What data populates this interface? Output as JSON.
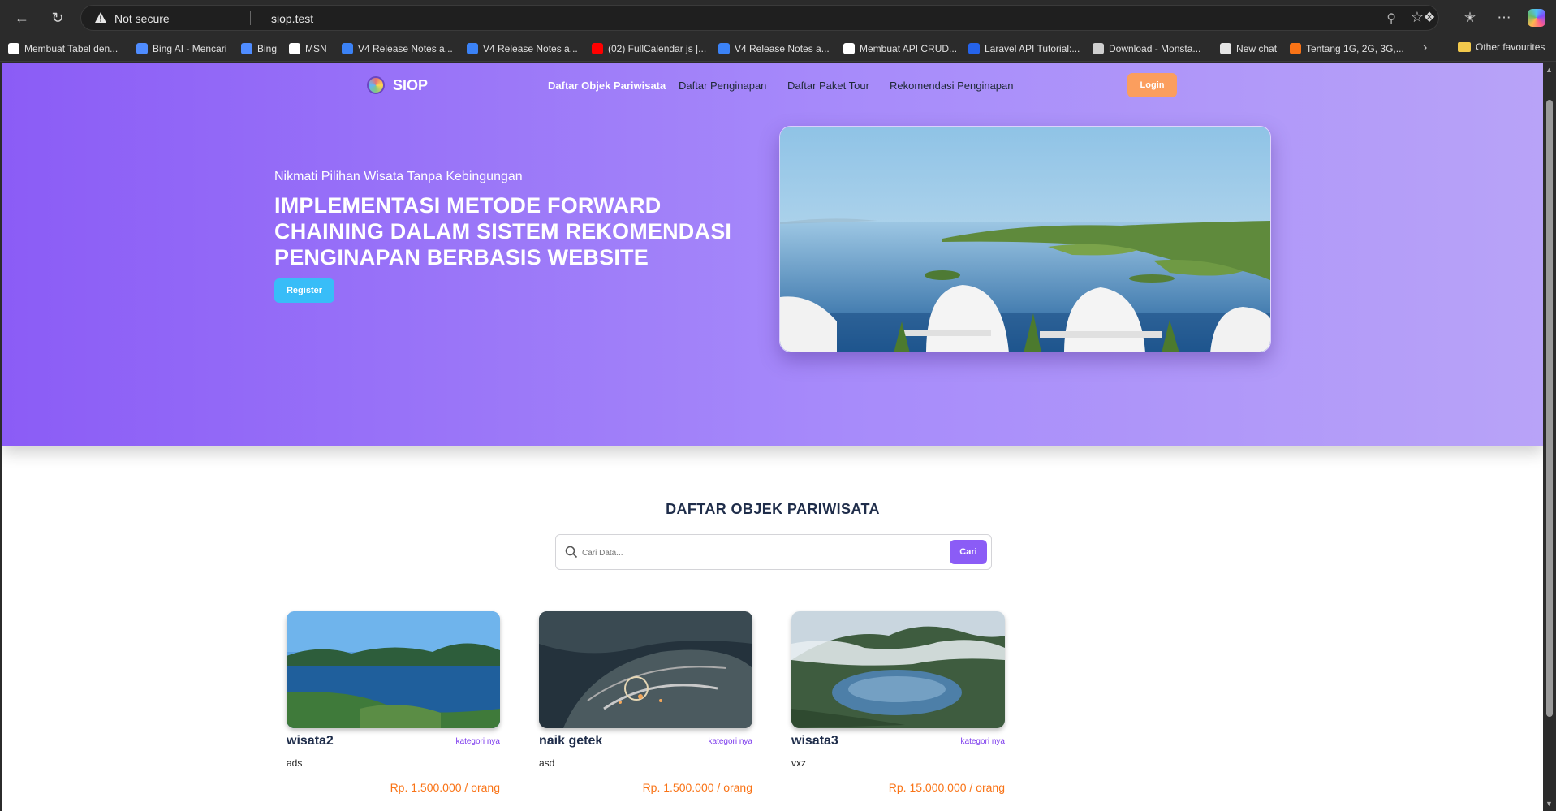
{
  "browser": {
    "security_label": "Not secure",
    "url": "siop.test",
    "bookmarks": [
      {
        "label": "Membuat Tabel den...",
        "icon": "medium-icon",
        "color": "#ffffff"
      },
      {
        "label": "Bing AI - Mencari",
        "icon": "bing-search-icon",
        "color": "#4f8cff"
      },
      {
        "label": "Bing",
        "icon": "bing-search-icon",
        "color": "#4f8cff"
      },
      {
        "label": "MSN",
        "icon": "msn-icon",
        "color": "#ffffff"
      },
      {
        "label": "V4 Release Notes a...",
        "icon": "page-icon",
        "color": "#3b82f6"
      },
      {
        "label": "V4 Release Notes a...",
        "icon": "page-icon",
        "color": "#3b82f6"
      },
      {
        "label": "(02) FullCalendar js |...",
        "icon": "youtube-icon",
        "color": "#ff0000"
      },
      {
        "label": "V4 Release Notes a...",
        "icon": "page-icon",
        "color": "#3b82f6"
      },
      {
        "label": "Membuat API CRUD...",
        "icon": "medium-icon",
        "color": "#ffffff"
      },
      {
        "label": "Laravel API Tutorial:...",
        "icon": "laravel-icon",
        "color": "#2563eb"
      },
      {
        "label": "Download - Monsta...",
        "icon": "document-icon",
        "color": "#cfcfcf"
      },
      {
        "label": "New chat",
        "icon": "openai-icon",
        "color": "#e5e5e5"
      },
      {
        "label": "Tentang 1G, 2G, 3G,...",
        "icon": "blogger-icon",
        "color": "#f97316"
      }
    ],
    "other_favourites": "Other favourites"
  },
  "site": {
    "logo_text": "SIOP",
    "nav": [
      {
        "label": "Daftar Objek Pariwisata",
        "active": true
      },
      {
        "label": "Daftar Penginapan",
        "active": false
      },
      {
        "label": "Daftar Paket Tour",
        "active": false
      },
      {
        "label": "Rekomendasi Penginapan",
        "active": false
      }
    ],
    "login_label": "Login"
  },
  "hero": {
    "subtitle": "Nikmati Pilihan Wisata Tanpa Kebingungan",
    "headline": "IMPLEMENTASI METODE FORWARD CHAINING DALAM SISTEM REKOMENDASI PENGINAPAN BERBASIS WEBSITE",
    "register_label": "Register"
  },
  "section": {
    "title": "DAFTAR OBJEK PARIWISATA",
    "search_placeholder": "Cari Data...",
    "search_button": "Cari"
  },
  "cards": [
    {
      "name": "wisata2",
      "category": "kategori nya",
      "description": "ads",
      "price": "Rp. 1.500.000 / orang"
    },
    {
      "name": "naik getek",
      "category": "kategori nya",
      "description": "asd",
      "price": "Rp. 1.500.000 / orang"
    },
    {
      "name": "wisata3",
      "category": "kategori nya",
      "description": "vxz",
      "price": "Rp. 15.000.000 / orang"
    }
  ],
  "colors": {
    "accent": "#8b5cf6",
    "login": "#fb9e5e",
    "register": "#38bdf8",
    "price": "#f97316"
  }
}
